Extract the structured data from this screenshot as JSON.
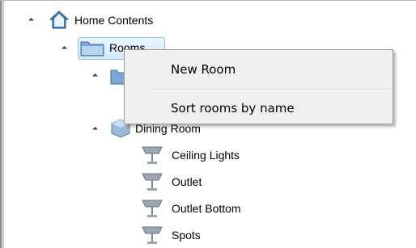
{
  "tree": {
    "root": {
      "label": "Home Contents"
    },
    "rooms": {
      "label": "Rooms"
    },
    "dining_room": {
      "label": "Dining Room"
    },
    "lights": [
      {
        "label": "Ceiling Lights"
      },
      {
        "label": "Outlet"
      },
      {
        "label": "Outlet Bottom"
      },
      {
        "label": "Spots"
      }
    ]
  },
  "context_menu": {
    "items": [
      {
        "label": "New Room"
      },
      {
        "label": "Sort rooms by name"
      }
    ]
  },
  "colors": {
    "selection_border": "#8fc3e8",
    "home_icon_blue": "#3d7fc4",
    "folder_blue": "#7aa8d6",
    "lamp_gray": "#8e9aa6"
  }
}
